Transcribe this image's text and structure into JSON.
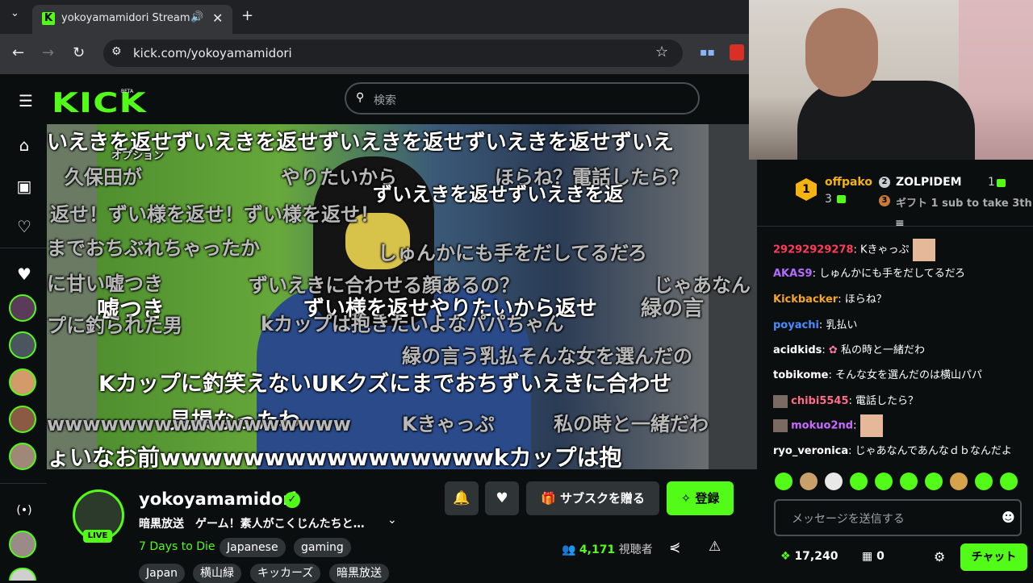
{
  "browser": {
    "tab_title": "yokoyamamidori Stream - \\",
    "url": "kick.com/yokoyamamidori"
  },
  "kick": {
    "logo": "KICK",
    "beta": "BETA",
    "search_placeholder": "検索"
  },
  "danmaku": [
    {
      "text": "いえきを返せずいえきを返せずいえきを返せずいえきを返せずいえ",
      "g": true
    },
    {
      "text": "オプション",
      "g": false
    },
    {
      "text": "久保田が",
      "g": true
    },
    {
      "text": "やりたいから",
      "g": true
    },
    {
      "text": "ほらね？電話したら？",
      "g": true
    },
    {
      "text": "ずいえきを返せずいえきを返",
      "g": false
    },
    {
      "text": "返せ！ずい様を返せ！ずい様を返せ！",
      "g": true
    },
    {
      "text": "までおちぶれちゃったか",
      "g": true
    },
    {
      "text": "しゅんかにも手をだしてるだろ",
      "g": true
    },
    {
      "text": "に甘い嘘つき",
      "g": true
    },
    {
      "text": "ずいえきに合わせる顔あるの？",
      "g": true
    },
    {
      "text": "じゃあなん",
      "g": true
    },
    {
      "text": "嘘つき",
      "g": false
    },
    {
      "text": "ずい様を返せやりたいから返せ",
      "g": false
    },
    {
      "text": "緑の言",
      "g": true
    },
    {
      "text": "プに釣られた男",
      "g": true
    },
    {
      "text": "kカップは抱きたいよなパパちゃん",
      "g": true
    },
    {
      "text": "緑の言う乳払そんな女を選んだの",
      "g": true
    },
    {
      "text": "Kカップに釣笑えないUKクズにまでおちずいえきに合わせ",
      "g": false
    },
    {
      "text": "見損なったわ",
      "g": false
    },
    {
      "text": "wwwwwwwwwwwwwwwww",
      "g": true
    },
    {
      "text": "Kきゃっぷ",
      "g": true
    },
    {
      "text": "私の時と一緒だわ",
      "g": true
    },
    {
      "text": "ょいなお前wwwwwwwwwwwwwwwwkカップは抱",
      "g": false
    }
  ],
  "channel": {
    "name": "yokoyamamidori",
    "live_label": "LIVE",
    "stream_title": "暗黒放送　ゲーム！素人がこくじんたちと…",
    "category": "7 Days to Die",
    "tags_row1": [
      "Japanese",
      "gaming"
    ],
    "tags_row2": [
      "Japan",
      "横山緑",
      "キッカーズ",
      "暗黒放送"
    ],
    "gift_sub_label": "サブスクを贈る",
    "follow_label": "登録",
    "viewer_count": "4,171",
    "viewer_label": "視聴者"
  },
  "leaderboard": {
    "first": {
      "rank": "1",
      "name": "offpako",
      "count": "3"
    },
    "second": {
      "rank": "2",
      "name": "ZOLPIDEM",
      "count": "1"
    },
    "third": {
      "rank": "3",
      "name": "ギフト 1 sub to take 3th"
    }
  },
  "chat": {
    "messages": [
      {
        "user": "29292929278",
        "color": "#ff3b5a",
        "text": "Kきゃっぷ"
      },
      {
        "user": "AKAS9",
        "color": "#b36bff",
        "text": "しゅんかにも手をだしてるだろ"
      },
      {
        "user": "Kickbacker",
        "color": "#f5a623",
        "text": "ほらね？"
      },
      {
        "user": "poyachi",
        "color": "#4a8cff",
        "text": "乳払い"
      },
      {
        "user": "acidkids",
        "color": "#ffffff",
        "text": "私の時と一緒だわ"
      },
      {
        "user": "tobikome",
        "color": "#ffffff",
        "text": "そんな女を選んだのは横山パパ"
      },
      {
        "user": "chibi5545",
        "color": "#ff6b8a",
        "text": "電話したら？"
      },
      {
        "user": "mokuo2nd",
        "color": "#c86bff",
        "text": ""
      },
      {
        "user": "ryo_veronica",
        "color": "#ffffff",
        "text": "じゃあなんであんなｄｂなんだよ"
      }
    ],
    "input_placeholder": "メッセージを送信する",
    "points": "17,240",
    "boxes": "0",
    "send_label": "チャット"
  },
  "colors": {
    "accent": "#53fc18",
    "background": "#0b0e0f"
  }
}
